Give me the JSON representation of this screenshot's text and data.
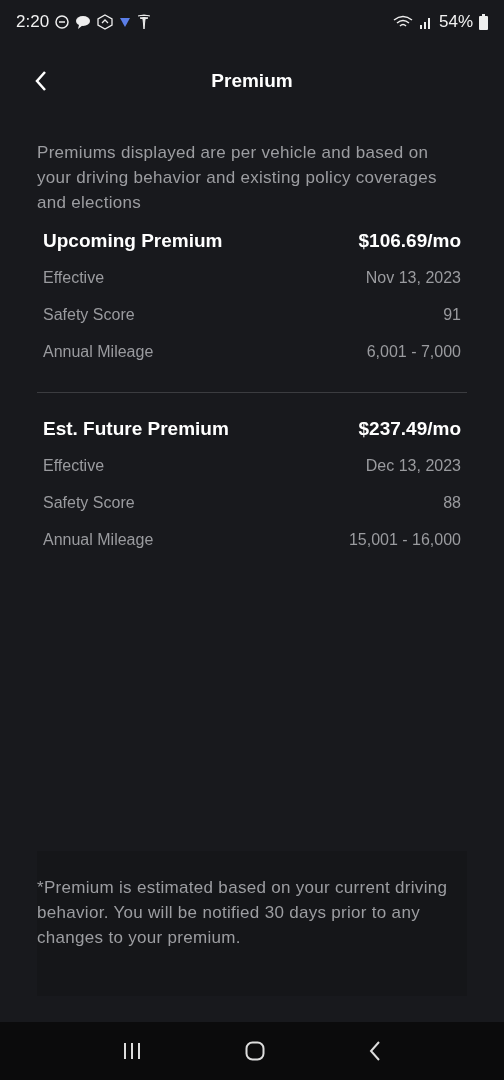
{
  "status_bar": {
    "time": "2:20",
    "battery": "54%"
  },
  "header": {
    "title": "Premium"
  },
  "intro": "Premiums displayed are per vehicle and based on your driving behavior and existing policy coverages and elections",
  "sections": [
    {
      "title": "Upcoming Premium",
      "amount": "$106.69/mo",
      "rows": [
        {
          "label": "Effective",
          "value": "Nov 13, 2023"
        },
        {
          "label": "Safety Score",
          "value": "91"
        },
        {
          "label": "Annual Mileage",
          "value": "6,001 - 7,000"
        }
      ]
    },
    {
      "title": "Est. Future Premium",
      "amount": "$237.49/mo",
      "rows": [
        {
          "label": "Effective",
          "value": "Dec 13, 2023"
        },
        {
          "label": "Safety Score",
          "value": "88"
        },
        {
          "label": "Annual Mileage",
          "value": "15,001 - 16,000"
        }
      ]
    }
  ],
  "footnote": "*Premium is estimated based on your current driving behavior. You will be notified 30 days prior to any changes to your premium."
}
